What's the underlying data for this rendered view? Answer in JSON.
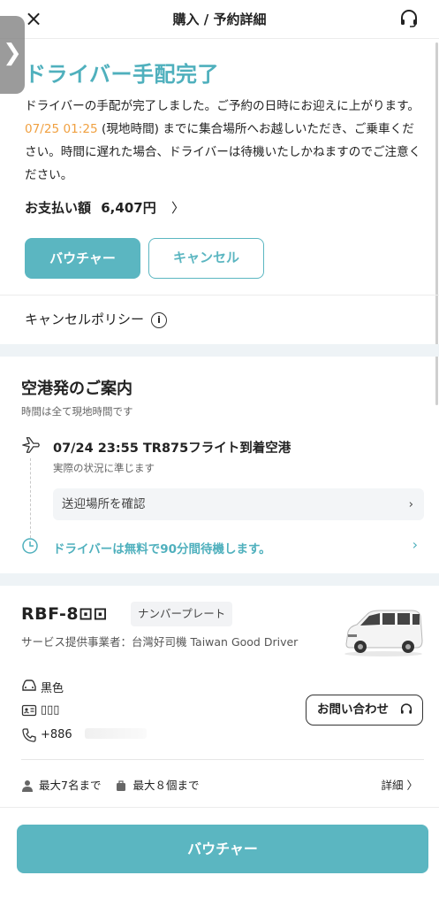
{
  "header": {
    "close_icon": "×",
    "title": "購入 / 予約詳細",
    "support_icon": "headset-icon"
  },
  "side_tab": {
    "glyph": "❯"
  },
  "status": {
    "title": "ドライバー手配完了",
    "desc_part1": "ドライバーの手配が完了しました。ご予約の日時にお迎えに上がります。",
    "desc_time": "07/25 01:25",
    "desc_part2": " (現地時間) までに集合場所へお越しいただき、ご乗車ください。時間に遅れた場合、ドライバーは待機いたしかねますのでご注意ください。",
    "accent_color": "#4fb0bd",
    "time_color": "#f0a040"
  },
  "payment": {
    "label": "お支払い額",
    "amount": "6,407円",
    "chevron": "〉"
  },
  "buttons": {
    "voucher": "バウチャー",
    "cancel": "キャンセル",
    "footer_voucher": "バウチャー",
    "contact": "お問い合わせ"
  },
  "policy": {
    "label": "キャンセルポリシー",
    "info": "i"
  },
  "airport": {
    "title": "空港発のご案内",
    "subtitle": "時間は全て現地時間です",
    "flight": "07/24 23:55 TR875フライト到着空港",
    "flight_sub": "実際の状況に準じます",
    "pickup_label": "送迎場所を確認",
    "pickup_chevron": "›",
    "wait_text": "ドライバーは無料で90分間待機します。",
    "wait_chevron": "›"
  },
  "vehicle": {
    "plate": "RBF-8⊡⊡",
    "plate_tag": "ナンバープレート",
    "provider": "サービス提供事業者：台灣好司機 Taiwan Good Driver",
    "color_label": "黒色",
    "driver_name": "▯▯▯",
    "phone": "+886"
  },
  "capacity": {
    "people": "最大7名まで",
    "luggage": "最大８個まで",
    "detail": "詳細 〉"
  }
}
